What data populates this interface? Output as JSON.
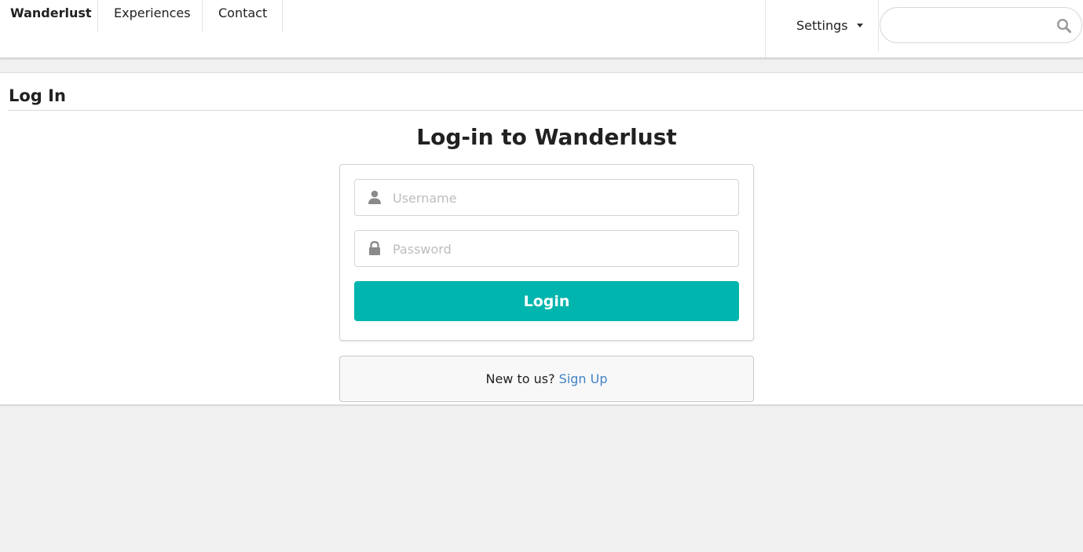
{
  "nav": {
    "brand": "Wanderlust",
    "items": [
      {
        "label": "Experiences"
      },
      {
        "label": "Contact"
      }
    ],
    "settings_label": "Settings",
    "search": {
      "placeholder": "",
      "value": ""
    }
  },
  "page": {
    "title": "Log In",
    "heading": "Log-in to Wanderlust"
  },
  "form": {
    "username_placeholder": "Username",
    "password_placeholder": "Password",
    "login_label": "Login"
  },
  "signup": {
    "prompt": "New to us?",
    "link_label": "Sign Up"
  },
  "colors": {
    "primary_button": "#00b5ad",
    "link": "#4183c4",
    "page_background": "#f0f0f0"
  },
  "icons": {
    "username": "user-icon",
    "password": "lock-icon",
    "search": "search-icon",
    "settings": "caret-down-icon"
  }
}
